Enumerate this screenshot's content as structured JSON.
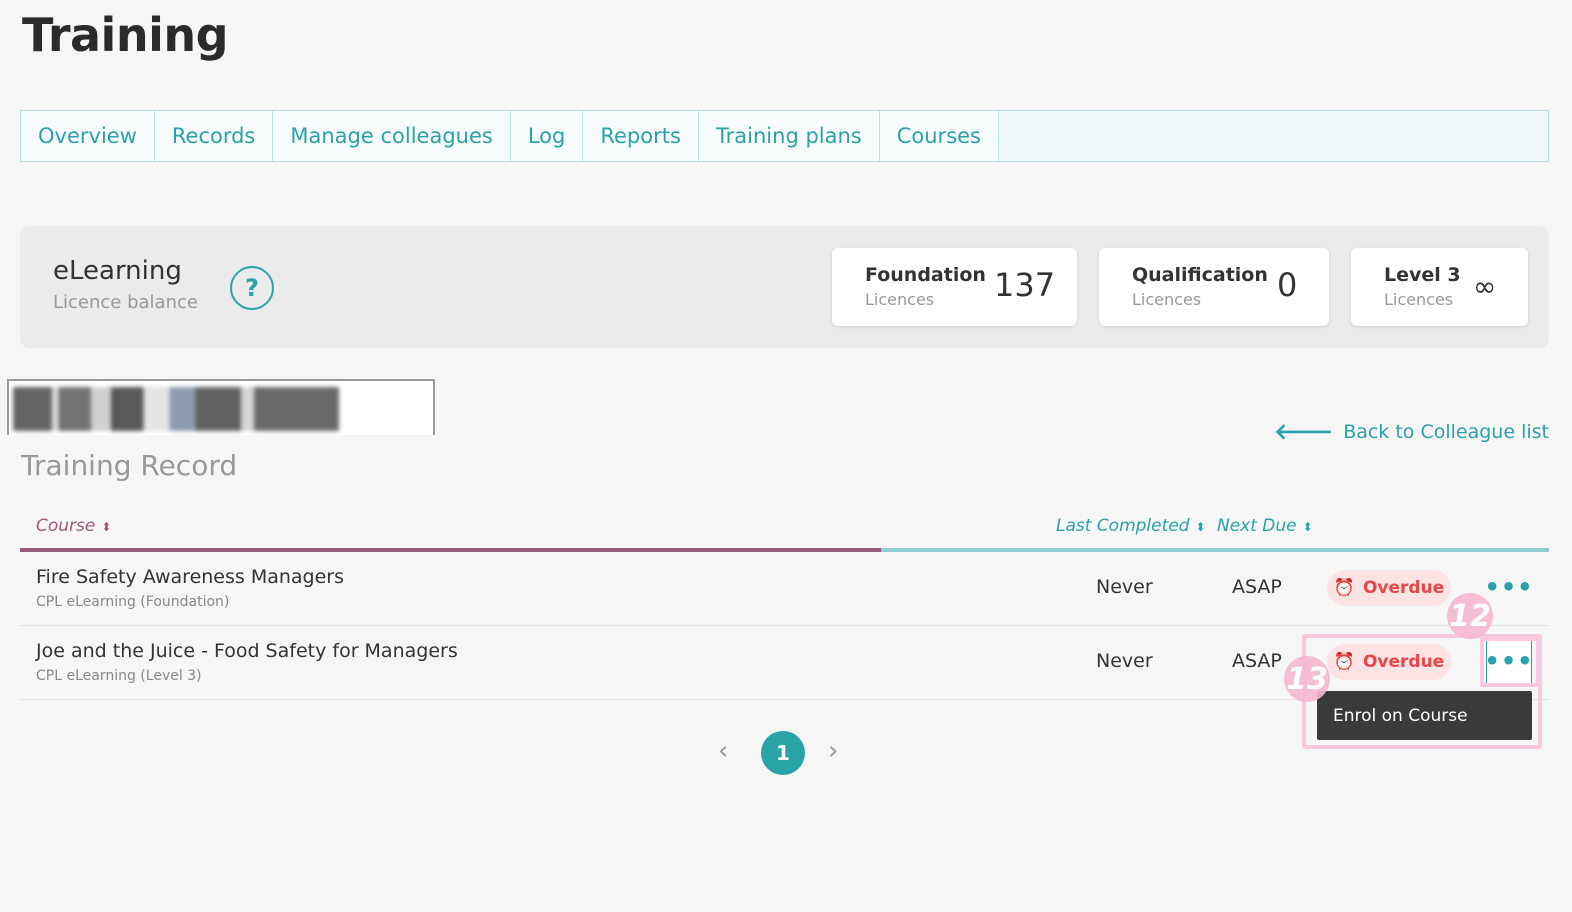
{
  "page": {
    "title": "Training"
  },
  "tabs": [
    {
      "label": "Overview"
    },
    {
      "label": "Records"
    },
    {
      "label": "Manage colleagues"
    },
    {
      "label": "Log"
    },
    {
      "label": "Reports"
    },
    {
      "label": "Training plans"
    },
    {
      "label": "Courses"
    }
  ],
  "licence_panel": {
    "title": "eLearning",
    "subtitle": "Licence balance",
    "help_icon": "question-circle-icon",
    "cards": [
      {
        "name": "Foundation",
        "sub": "Licences",
        "value": "137"
      },
      {
        "name": "Qualification",
        "sub": "Licences",
        "value": "0"
      },
      {
        "name": "Level 3",
        "sub": "Licences",
        "value": "∞"
      }
    ]
  },
  "record": {
    "back_link": "Back to Colleague list",
    "back_icon": "arrow-left-icon",
    "title": "Training Record",
    "columns": {
      "course": "Course",
      "last_completed": "Last Completed",
      "next_due": "Next Due"
    },
    "rows": [
      {
        "name": "Fire Safety Awareness Managers",
        "sub": "CPL eLearning (Foundation)",
        "last": "Never",
        "next": "ASAP",
        "status": "Overdue",
        "status_icon": "alarm-clock-icon"
      },
      {
        "name": "Joe and the Juice - Food Safety for Managers",
        "sub": "CPL eLearning (Level 3)",
        "last": "Never",
        "next": "ASAP",
        "status": "Overdue",
        "status_icon": "alarm-clock-icon"
      }
    ],
    "more_icon": "•••",
    "menu": {
      "item": "Enrol on Course"
    }
  },
  "annotations": {
    "a": "12",
    "b": "13"
  },
  "pagination": {
    "prev": "‹",
    "page": "1",
    "next": "›"
  },
  "colors": {
    "accent": "#2aa3a6",
    "course_accent": "#9b5a7b",
    "overdue": "#e84646",
    "highlight": "#f8c8de"
  }
}
